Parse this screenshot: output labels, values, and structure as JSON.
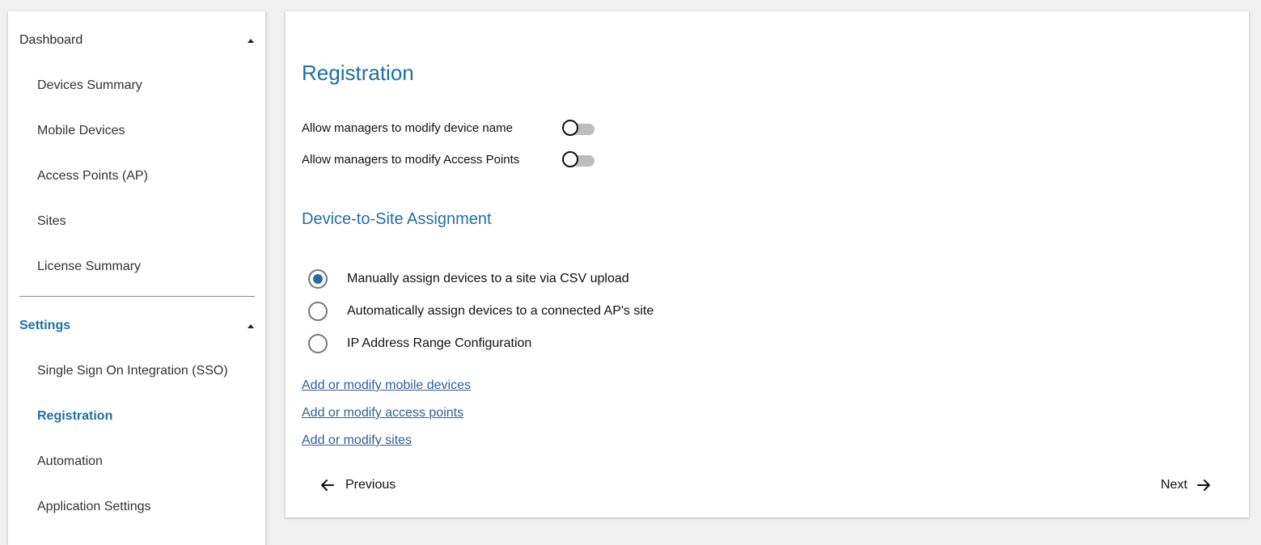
{
  "sidebar": {
    "dashboard": {
      "label": "Dashboard",
      "items": [
        "Devices Summary",
        "Mobile Devices",
        "Access Points (AP)",
        "Sites",
        "License Summary"
      ]
    },
    "settings": {
      "label": "Settings",
      "items": [
        "Single Sign On Integration (SSO)",
        "Registration",
        "Automation",
        "Application Settings"
      ],
      "active_item": "Registration"
    }
  },
  "main": {
    "title": "Registration",
    "toggles": [
      {
        "label": "Allow managers to modify device name",
        "state": "off"
      },
      {
        "label": "Allow managers to modify Access Points",
        "state": "off"
      }
    ],
    "assignment": {
      "title": "Device-to-Site Assignment",
      "options": [
        {
          "label": "Manually assign devices to a site via CSV upload",
          "selected": true
        },
        {
          "label": "Automatically assign devices to a connected AP's site",
          "selected": false
        },
        {
          "label": "IP Address Range Configuration",
          "selected": false
        }
      ]
    },
    "links": [
      "Add or modify mobile devices",
      "Add or modify access points",
      "Add or modify sites"
    ],
    "nav": {
      "previous_label": "Previous",
      "next_label": "Next"
    }
  },
  "colors": {
    "accent": "#1f6fa6",
    "link": "#2f5f9e",
    "background": "#f0f0f0",
    "toggle_track_off": "#bdbdbd"
  },
  "icons": {
    "section_caret": "caret-up-icon",
    "previous": "arrow-left-icon",
    "next": "arrow-right-icon"
  }
}
